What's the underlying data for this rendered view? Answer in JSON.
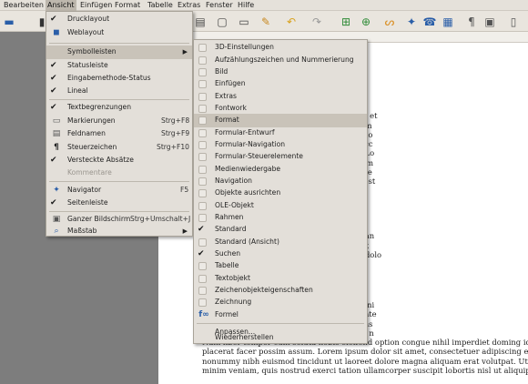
{
  "menubar": {
    "items": [
      "Bearbeiten",
      "Ansicht",
      "Einfügen",
      "Format",
      "Tabelle",
      "Extras",
      "Fenster",
      "Hilfe"
    ],
    "active": "Ansicht"
  },
  "toolbar": {
    "icons": [
      "save-icon",
      "pdf-icon",
      "print-icon",
      "preview-icon",
      "spellcheck-icon",
      "autospell-icon",
      "cut-icon",
      "copy-icon",
      "paste-icon",
      "clone-format-icon",
      "undo-icon",
      "redo-icon",
      "hyperlink-icon",
      "table-icon",
      "image-icon",
      "chart-icon",
      "show-draw-functions-icon",
      "navigator-icon",
      "gallery-icon",
      "data-sources-icon",
      "nonprinting-chars-icon",
      "zoom-icon",
      "help-icon"
    ]
  },
  "view_menu": {
    "items": [
      {
        "label": "Drucklayout",
        "checked": true
      },
      {
        "label": "Weblayout",
        "icon": "web-layout-icon"
      },
      {
        "label": "Symbolleisten",
        "submenu": true,
        "highlighted": true
      },
      {
        "label": "Statusleiste",
        "checked": true
      },
      {
        "label": "Eingabemethode-Status",
        "checked": true
      },
      {
        "label": "Lineal",
        "checked": true
      },
      {
        "label": "Textbegrenzungen",
        "checked": true
      },
      {
        "label": "Markierungen",
        "shortcut": "Strg+F8",
        "icon": "field-shadings-icon"
      },
      {
        "label": "Feldnamen",
        "shortcut": "Strg+F9",
        "icon": "field-names-icon"
      },
      {
        "label": "Steuerzeichen",
        "shortcut": "Strg+F10",
        "icon": "pilcrow-icon"
      },
      {
        "label": "Versteckte Absätze",
        "checked": true
      },
      {
        "label": "Kommentare",
        "disabled": true
      },
      {
        "label": "Navigator",
        "shortcut": "F5",
        "icon": "navigator-icon"
      },
      {
        "label": "Seitenleiste",
        "checked": true
      },
      {
        "label": "Ganzer Bildschirm",
        "shortcut": "Strg+Umschalt+J",
        "icon": "fullscreen-icon"
      },
      {
        "label": "Maßstab",
        "submenu": true,
        "icon": "zoom-icon"
      }
    ]
  },
  "toolbars_submenu": {
    "items": [
      {
        "label": "3D-Einstellungen"
      },
      {
        "label": "Aufzählungszeichen und Nummerierung"
      },
      {
        "label": "Bild"
      },
      {
        "label": "Einfügen"
      },
      {
        "label": "Extras"
      },
      {
        "label": "Fontwork"
      },
      {
        "label": "Format",
        "highlighted": true
      },
      {
        "label": "Formular-Entwurf"
      },
      {
        "label": "Formular-Navigation"
      },
      {
        "label": "Formular-Steuerelemente"
      },
      {
        "label": "Medienwiedergabe"
      },
      {
        "label": "Navigation"
      },
      {
        "label": "Objekte ausrichten"
      },
      {
        "label": "OLE-Objekt"
      },
      {
        "label": "Rahmen"
      },
      {
        "label": "Standard",
        "checked": true
      },
      {
        "label": "Standard (Ansicht)"
      },
      {
        "label": "Suchen",
        "checked": true
      },
      {
        "label": "Tabelle"
      },
      {
        "label": "Textobjekt"
      },
      {
        "label": "Zeichenobjekteigenschaften"
      },
      {
        "label": "Zeichnung"
      },
      {
        "label": "Formel",
        "icon": "formula-icon"
      },
      {
        "label": "Anpassen..."
      },
      {
        "label": "Wiederherstellen"
      }
    ]
  },
  "document": {
    "lines_top": [
      "ipscing elitr, sed diam nonumy eirmod tem",
      "sed diam voluptua. At vero eos et accusam et",
      "a, no sea takimata sanctus est Lorem ipsum",
      "tur sadipscing elitr, sed diam nonumy eirmo",
      "t erat, sed diam voluptua. At vero eos et acc",
      "d gubergren, no sea takimata sanctus est Lo",
      "consetetur sadipscing elitr, sed diam nonum",
      "uyam erat, sed diam voluptua. At vero eos e",
      "kasd gubergren, no sea takimata sanctus est"
    ],
    "lines_mid": [
      "in vulputate velit esse molestie consequat,",
      "et accumsan et iusto odio dignissim qui blan",
      "feugait nulla facilisi. Lorem ipsum dolor sit",
      "nummy nibh euismod tincidunt ut laoreet dolo"
    ],
    "lines_bottom": [
      "exerci tation ullamcorper suscipit lobortis ni",
      "vel eum iriure dolor in hendrerit in vulputate",
      "feugiat nulla facilisis at vero eros et accums",
      "n zzril delenit augue duis dolore te feugait n",
      "Nam liber tempor cum soluta nobis eleifend option congue nihil imperdiet doming id qu",
      "placerat facer possim assum. Lorem ipsum dolor sit amet, consectetuer adipiscing elit, s",
      "nonummy nibh euismod tincidunt ut laoreet dolore magna aliquam erat volutpat. Ut wisi",
      "minim veniam, quis nostrud exerci tation ullamcorper suscipit lobortis nisl ut aliquip ex"
    ]
  }
}
